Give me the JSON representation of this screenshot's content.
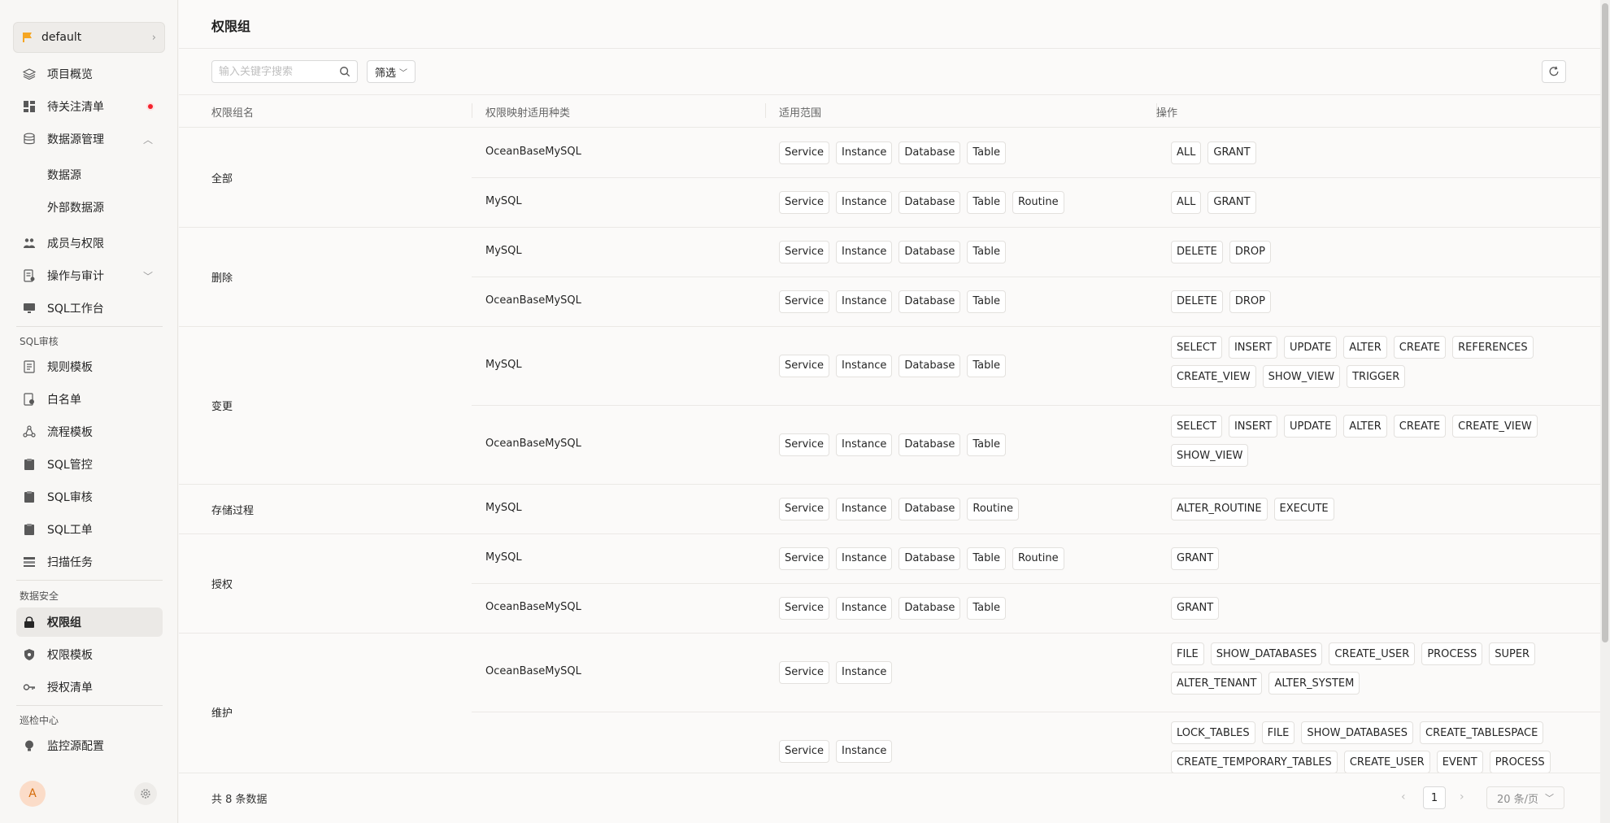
{
  "sidebar": {
    "project": "default",
    "items": [
      {
        "label": "项目概览",
        "icon": "layers-icon"
      },
      {
        "label": "待关注清单",
        "icon": "dashboard-icon"
      },
      {
        "label": "数据源管理",
        "icon": "database-icon"
      },
      {
        "label": "数据源"
      },
      {
        "label": "外部数据源"
      },
      {
        "label": "成员与权限",
        "icon": "members-icon"
      },
      {
        "label": "操作与审计",
        "icon": "audit-icon"
      },
      {
        "label": "SQL工作台",
        "icon": "monitor-icon"
      }
    ],
    "sql_review_section": "SQL审核",
    "sql_items": [
      {
        "label": "规则模板",
        "icon": "rule-template-icon"
      },
      {
        "label": "白名单",
        "icon": "whitelist-icon"
      },
      {
        "label": "流程模板",
        "icon": "workflow-icon"
      },
      {
        "label": "SQL管控",
        "icon": "clipboard-icon"
      },
      {
        "label": "SQL审核",
        "icon": "clipboard-check-icon"
      },
      {
        "label": "SQL工单",
        "icon": "clipboard-list-icon"
      },
      {
        "label": "扫描任务",
        "icon": "scan-icon"
      }
    ],
    "security_section": "数据安全",
    "security_items": [
      {
        "label": "权限组",
        "icon": "lock-icon"
      },
      {
        "label": "权限模板",
        "icon": "shield-icon"
      },
      {
        "label": "授权清单",
        "icon": "key-icon"
      }
    ],
    "inspection_section": "巡检中心",
    "inspection_items": [
      {
        "label": "监控源配置",
        "icon": "bulb-icon"
      }
    ],
    "avatar": "A",
    "accent": "#f5a623"
  },
  "main": {
    "title": "权限组",
    "search_placeholder": "输入关键字搜索",
    "filter_label": "筛选",
    "columns": [
      "权限组名",
      "权限映射适用种类",
      "适用范围",
      "操作"
    ],
    "total_text": "共 8 条数据",
    "page": "1",
    "page_size": "20 条/页"
  },
  "groups": [
    {
      "name": "全部",
      "rows": [
        {
          "type": "OceanBaseMySQL",
          "scope": [
            "Service",
            "Instance",
            "Database",
            "Table"
          ],
          "ops": [
            "ALL",
            "GRANT"
          ]
        },
        {
          "type": "MySQL",
          "scope": [
            "Service",
            "Instance",
            "Database",
            "Table",
            "Routine"
          ],
          "ops": [
            "ALL",
            "GRANT"
          ]
        }
      ]
    },
    {
      "name": "删除",
      "rows": [
        {
          "type": "MySQL",
          "scope": [
            "Service",
            "Instance",
            "Database",
            "Table"
          ],
          "ops": [
            "DELETE",
            "DROP"
          ]
        },
        {
          "type": "OceanBaseMySQL",
          "scope": [
            "Service",
            "Instance",
            "Database",
            "Table"
          ],
          "ops": [
            "DELETE",
            "DROP"
          ]
        }
      ]
    },
    {
      "name": "变更",
      "rows": [
        {
          "type": "MySQL",
          "scope": [
            "Service",
            "Instance",
            "Database",
            "Table"
          ],
          "ops": [
            "SELECT",
            "INSERT",
            "UPDATE",
            "ALTER",
            "CREATE",
            "REFERENCES",
            "CREATE_VIEW",
            "SHOW_VIEW",
            "TRIGGER"
          ]
        },
        {
          "type": "OceanBaseMySQL",
          "scope": [
            "Service",
            "Instance",
            "Database",
            "Table"
          ],
          "ops": [
            "SELECT",
            "INSERT",
            "UPDATE",
            "ALTER",
            "CREATE",
            "CREATE_VIEW",
            "SHOW_VIEW"
          ]
        }
      ]
    },
    {
      "name": "存储过程",
      "rows": [
        {
          "type": "MySQL",
          "scope": [
            "Service",
            "Instance",
            "Database",
            "Routine"
          ],
          "ops": [
            "ALTER_ROUTINE",
            "EXECUTE"
          ]
        }
      ]
    },
    {
      "name": "授权",
      "rows": [
        {
          "type": "MySQL",
          "scope": [
            "Service",
            "Instance",
            "Database",
            "Table",
            "Routine"
          ],
          "ops": [
            "GRANT"
          ]
        },
        {
          "type": "OceanBaseMySQL",
          "scope": [
            "Service",
            "Instance",
            "Database",
            "Table"
          ],
          "ops": [
            "GRANT"
          ]
        }
      ]
    },
    {
      "name": "维护",
      "rows": [
        {
          "type": "OceanBaseMySQL",
          "scope": [
            "Service",
            "Instance"
          ],
          "ops": [
            "FILE",
            "SHOW_DATABASES",
            "CREATE_USER",
            "PROCESS",
            "SUPER",
            "ALTER_TENANT",
            "ALTER_SYSTEM"
          ]
        },
        {
          "type": "",
          "scope": [
            "Service",
            "Instance"
          ],
          "ops": [
            "LOCK_TABLES",
            "FILE",
            "SHOW_DATABASES",
            "CREATE_TABLESPACE",
            "CREATE_TEMPORARY_TABLES",
            "CREATE_USER",
            "EVENT",
            "PROCESS"
          ]
        }
      ]
    }
  ]
}
